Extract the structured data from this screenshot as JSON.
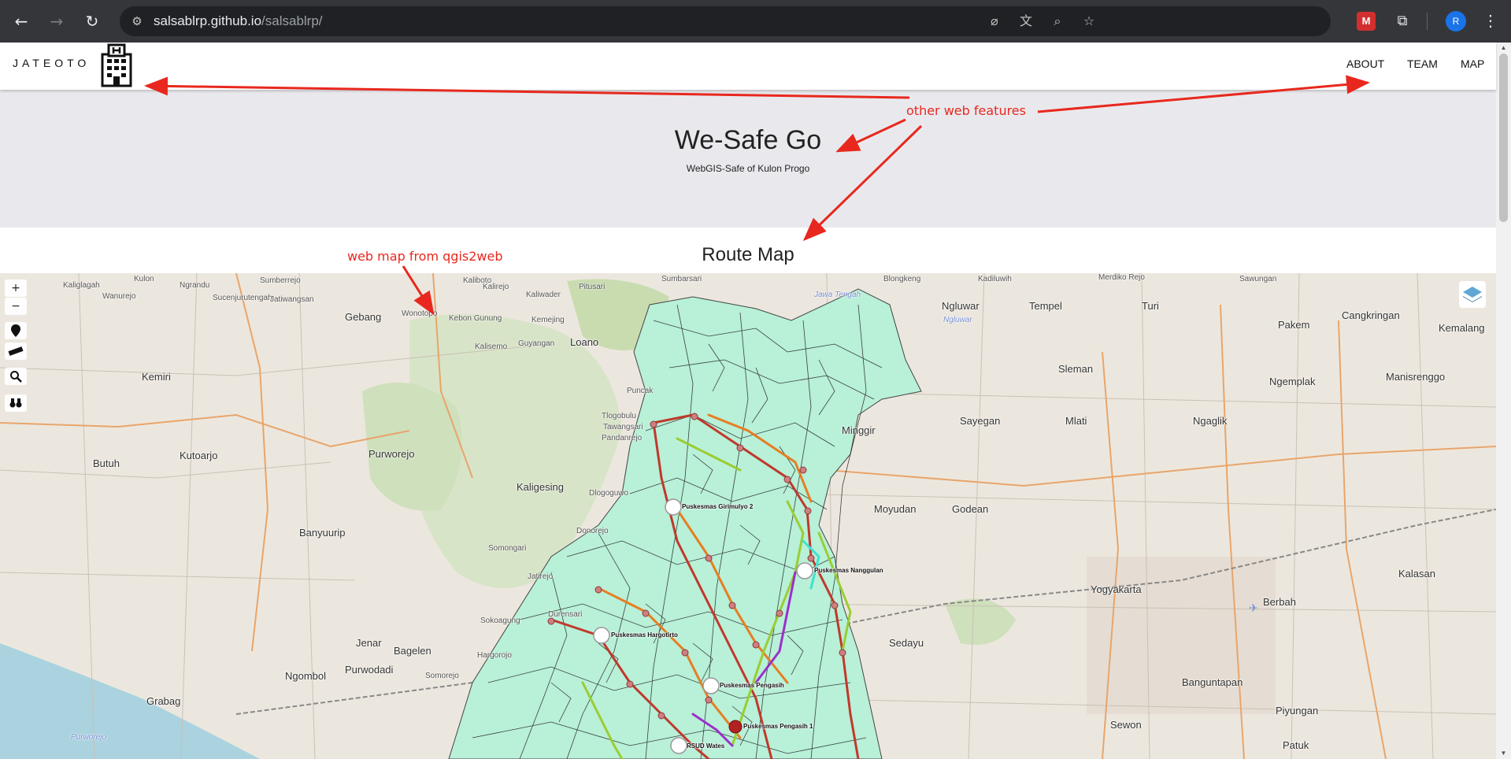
{
  "browser": {
    "url_host": "salsablrp.github.io",
    "url_path": "/salsablrp/",
    "profile_initial": "R",
    "extension_label": "M"
  },
  "site": {
    "brand": "JATEOTO",
    "nav": [
      "ABOUT",
      "TEAM",
      "MAP"
    ]
  },
  "hero": {
    "title": "We-Safe Go",
    "subtitle": "WebGIS-Safe of Kulon Progo"
  },
  "route_section": {
    "title": "Route Map"
  },
  "map": {
    "controls": [
      "+",
      "−"
    ],
    "place_labels": [
      "Kulon",
      "Kaliglagah",
      "Wanurejo",
      "Sucenjurutengah",
      "Ngrandu",
      "Jatiwangsan",
      "Sumberrejo",
      "Kaliboto",
      "Kaliwader",
      "Kalirejo",
      "Pitusari",
      "Wonotopo",
      "Gebang",
      "Kebon Gunung",
      "Kemejing",
      "Loano",
      "Guyangan",
      "Kalisemo",
      "Puncak",
      "Sumbarsari",
      "Blongkeng",
      "Kadiluwih",
      "Merdiko Rejo",
      "Sawungan",
      "Kemiri",
      "Purworejo",
      "Kaligesing",
      "Kutoarjo",
      "Butuh",
      "Banyuurip",
      "Bagelen",
      "Purwodadi",
      "Ngombol",
      "Grabag",
      "Jenar",
      "Tlogobulu",
      "Tawangsari",
      "Pandanrejo",
      "Dlogoguwo",
      "Somongari",
      "Donorejo",
      "Jatirejo",
      "Durensari",
      "Sokoagung",
      "Hargorojo",
      "Somorejo",
      "Ngluwar",
      "Tempel",
      "Turi",
      "Pakem",
      "Cangkringan",
      "Kemalang",
      "Sleman",
      "Ngemplak",
      "Manisrenggo",
      "Minggir",
      "Sayegan",
      "Mlati",
      "Ngaglik",
      "Moyudan",
      "Godean",
      "Yogyakarta",
      "Berbah",
      "Kalasan",
      "Sedayu",
      "Banguntapan",
      "Sewon",
      "Piyungan",
      "Patuk"
    ],
    "poi_labels": [
      "Puskesmas Girimulyo 2",
      "Puskesmas Nanggulan",
      "Puskesmas Hargotirto",
      "Puskesmas Pengasih",
      "Puskesmas Pengasih 1",
      "RSUD Wates"
    ],
    "water_labels": [
      "Jawa Tengah",
      "Ngluwar",
      "Purworejo"
    ]
  },
  "annotations": {
    "other_features": "other web features",
    "web_map": "web map from qgis2web"
  },
  "colors": {
    "annotation": "#e8281e",
    "route_red": "#c0392b",
    "route_orange": "#e67e22",
    "route_lime": "#9acd32",
    "route_purple": "#9b30c8",
    "region_fill": "#b8f0d8"
  }
}
